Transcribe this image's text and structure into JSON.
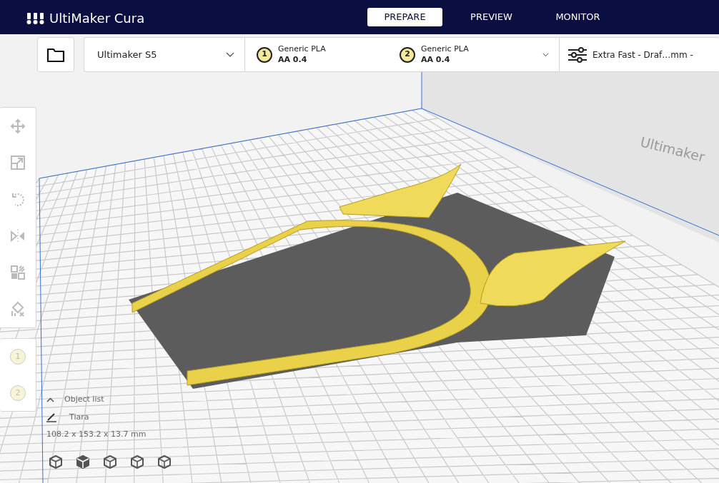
{
  "app": {
    "title": "UltiMaker Cura"
  },
  "tabs": [
    {
      "label": "PREPARE",
      "selected": true
    },
    {
      "label": "PREVIEW",
      "selected": false
    },
    {
      "label": "MONITOR",
      "selected": false
    }
  ],
  "printer": {
    "name": "Ultimaker S5"
  },
  "extruders": [
    {
      "number": "1",
      "material": "Generic PLA",
      "core": "AA 0.4"
    },
    {
      "number": "2",
      "material": "Generic PLA",
      "core": "AA 0.4"
    }
  ],
  "profile": {
    "label": "Extra Fast - Draf…mm -"
  },
  "extruder_buttons": [
    "1",
    "2"
  ],
  "viewport": {
    "printer_label": "Ultimaker"
  },
  "object_list": {
    "title": "Object list",
    "object_name": "Tiara",
    "dimensions": "108.2 x 153.2 x 13.7 mm"
  }
}
